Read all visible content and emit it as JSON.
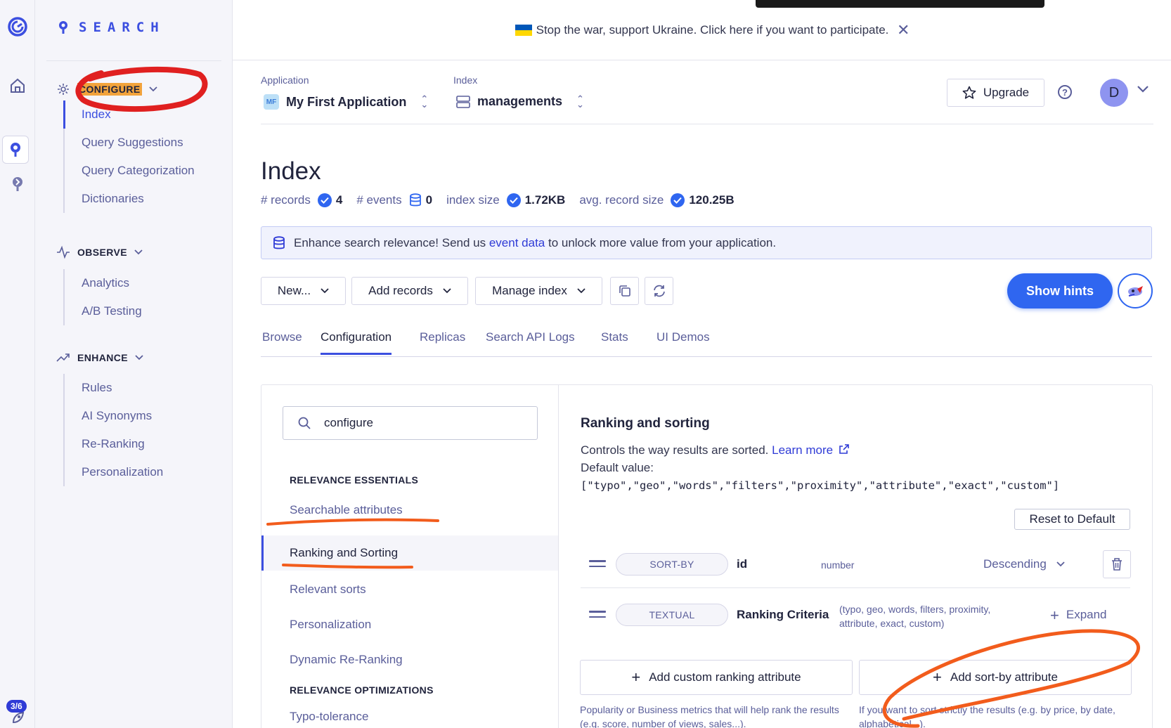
{
  "brand": {
    "logo_text": "SEARCH"
  },
  "rail": {
    "progress_badge": "3/6"
  },
  "nav": {
    "configure": {
      "label": "CONFIGURE",
      "items": [
        {
          "label": "Index",
          "active": true
        },
        {
          "label": "Query Suggestions"
        },
        {
          "label": "Query Categorization"
        },
        {
          "label": "Dictionaries"
        }
      ]
    },
    "observe": {
      "label": "OBSERVE",
      "items": [
        {
          "label": "Analytics"
        },
        {
          "label": "A/B Testing"
        }
      ]
    },
    "enhance": {
      "label": "ENHANCE",
      "items": [
        {
          "label": "Rules"
        },
        {
          "label": "AI Synonyms"
        },
        {
          "label": "Re-Ranking"
        },
        {
          "label": "Personalization"
        }
      ]
    }
  },
  "banner": {
    "text": "Stop the war, support Ukraine. Click here if you want to participate."
  },
  "header": {
    "application_label": "Application",
    "application_badge": "MF",
    "application_name": "My First Application",
    "index_label": "Index",
    "index_name": "managements",
    "upgrade_label": "Upgrade",
    "avatar_initial": "D"
  },
  "page": {
    "title": "Index",
    "stats": {
      "records_label": "# records",
      "records_value": "4",
      "events_label": "# events",
      "events_value": "0",
      "size_label": "index size",
      "size_value": "1.72KB",
      "avg_label": "avg. record size",
      "avg_value": "120.25B"
    },
    "notice": {
      "before": "Enhance search relevance! Send us ",
      "link": "event data",
      "after": " to unlock more value from your application."
    }
  },
  "toolbar": {
    "new_label": "New...",
    "add_records_label": "Add records",
    "manage_index_label": "Manage index",
    "show_hints_label": "Show hints"
  },
  "tabs": [
    {
      "label": "Browse"
    },
    {
      "label": "Configuration",
      "active": true
    },
    {
      "label": "Replicas"
    },
    {
      "label": "Search API Logs"
    },
    {
      "label": "Stats"
    },
    {
      "label": "UI Demos"
    }
  ],
  "settings": {
    "search_value": "configure",
    "category1": "RELEVANCE ESSENTIALS",
    "items": [
      {
        "label": "Searchable attributes"
      },
      {
        "label": "Ranking and Sorting",
        "active": true
      },
      {
        "label": "Relevant sorts"
      },
      {
        "label": "Personalization"
      },
      {
        "label": "Dynamic Re-Ranking"
      }
    ],
    "category2": "RELEVANCE OPTIMIZATIONS",
    "partial_item": "Typo-tolerance"
  },
  "ranking": {
    "title": "Ranking and sorting",
    "description": "Controls the way results are sorted. ",
    "learn_more": "Learn more",
    "default_label": "Default value:",
    "default_value": "[\"typo\",\"geo\",\"words\",\"filters\",\"proximity\",\"attribute\",\"exact\",\"custom\"]",
    "reset_label": "Reset to Default",
    "criteria": [
      {
        "pill": "SORT-BY",
        "name": "id",
        "type": "number",
        "order": "Descending"
      },
      {
        "pill": "TEXTUAL",
        "name": "Ranking Criteria",
        "sub": "(typo, geo, words, filters, proximity, attribute, exact, custom)",
        "expand": "Expand"
      }
    ],
    "add_custom_label": "Add custom ranking attribute",
    "add_custom_help": "Popularity or Business metrics that will help rank the results (e.g. score, number of views, sales...).",
    "add_sort_label": "Add sort-by attribute",
    "add_sort_help": "If you want to sort strictly the results (e.g. by price, by date, alphabetical...)."
  },
  "colors": {
    "accent": "#3c4fe0",
    "primary_button": "#2f66f0",
    "annotation": "#e02020",
    "annotation_orange": "#f25c1c",
    "highlight": "#f2a33b"
  }
}
